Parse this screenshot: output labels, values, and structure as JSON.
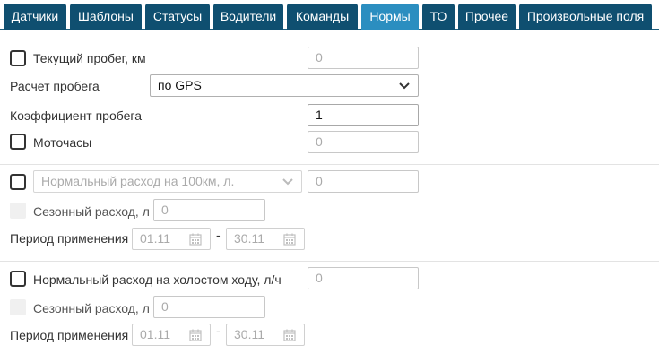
{
  "tabs": [
    {
      "label": "Датчики",
      "active": false
    },
    {
      "label": "Шаблоны",
      "active": false
    },
    {
      "label": "Статусы",
      "active": false
    },
    {
      "label": "Водители",
      "active": false
    },
    {
      "label": "Команды",
      "active": false
    },
    {
      "label": "Нормы",
      "active": true
    },
    {
      "label": "ТО",
      "active": false
    },
    {
      "label": "Прочее",
      "active": false
    },
    {
      "label": "Произвольные поля",
      "active": false
    }
  ],
  "colors": {
    "tab_bg": "#0f4f70",
    "tab_active_bg": "#2b8ec0"
  },
  "form": {
    "current_mileage": {
      "label": "Текущий пробег, км",
      "checked": false,
      "placeholder": "0"
    },
    "mileage_calc": {
      "label": "Расчет пробега",
      "value": "по GPS"
    },
    "mileage_coef": {
      "label": "Коэффициент пробега",
      "value": "1"
    },
    "engine_hours": {
      "label": "Моточасы",
      "checked": false,
      "placeholder": "0"
    },
    "norm_100km": {
      "select_placeholder": "Нормальный расход на 100км, л.",
      "checked": false,
      "placeholder": "0"
    },
    "seasonal_1": {
      "label": "Сезонный расход, л",
      "placeholder": "0"
    },
    "period_1": {
      "label": "Период применения",
      "from": "01.11",
      "separator": "-",
      "to": "30.11"
    },
    "idle_norm": {
      "label": "Нормальный расход на холостом ходу, л/ч",
      "checked": false,
      "placeholder": "0"
    },
    "seasonal_2": {
      "label": "Сезонный расход, л",
      "placeholder": "0"
    },
    "period_2": {
      "label": "Период применения",
      "from": "01.11",
      "separator": "-",
      "to": "30.11"
    }
  }
}
